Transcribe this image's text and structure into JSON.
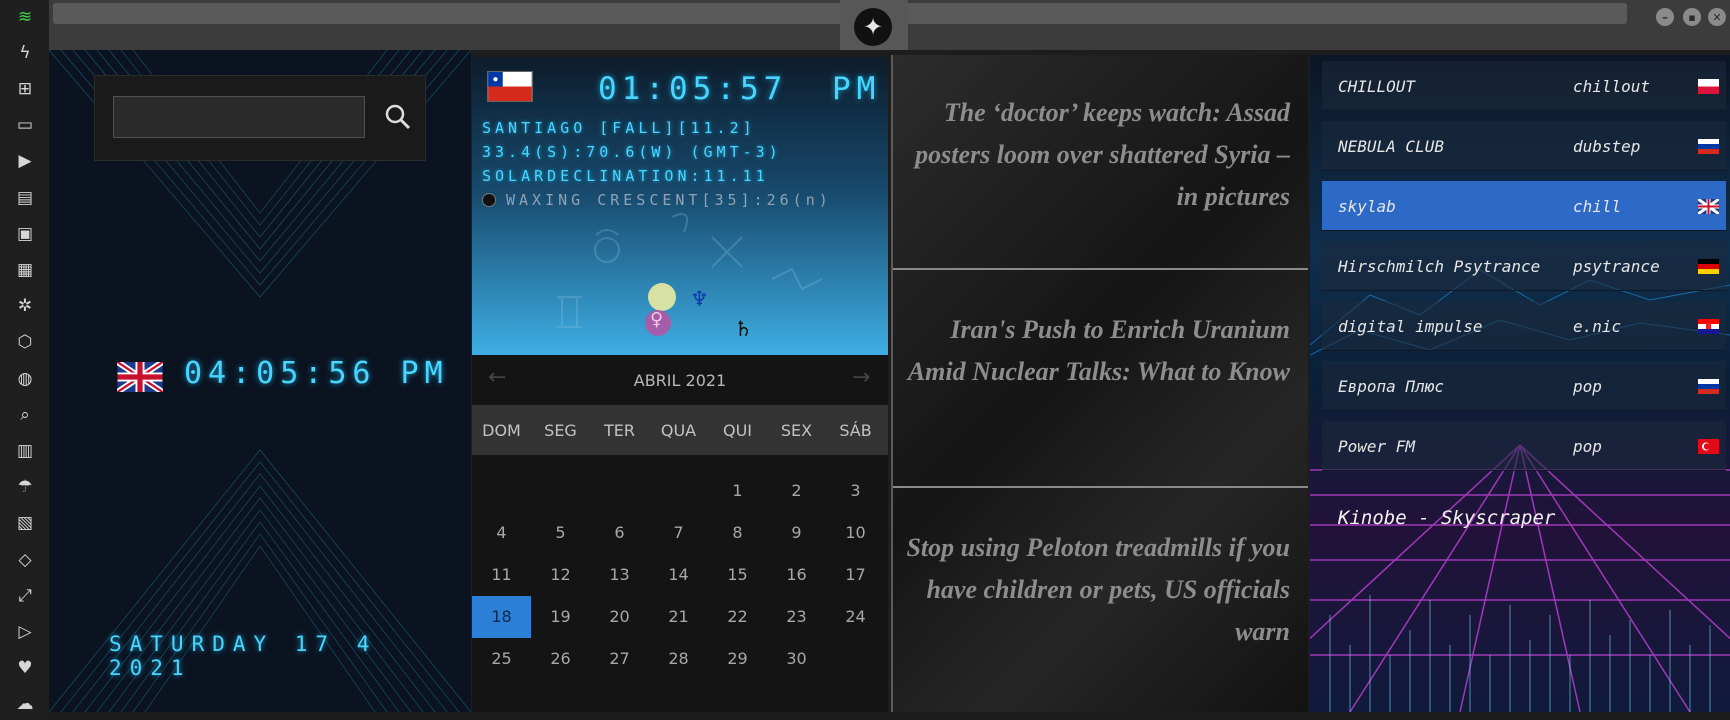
{
  "sidebar": {
    "icons": [
      "wifi-icon",
      "bolt-icon",
      "windows-icon",
      "archive-icon",
      "play-icon",
      "map-book-icon",
      "image-icon",
      "newspaper-icon",
      "aperture-icon",
      "hexagon-icon",
      "globe-icon",
      "search-icon",
      "map-icon",
      "umbrella-icon",
      "contact-card-icon",
      "code-icon",
      "expand-icon",
      "youtube-icon",
      "heart-icon",
      "cloud-icon"
    ]
  },
  "local_clock": {
    "time": "04:05:56 PM",
    "date": "SATURDAY 17 4 2021"
  },
  "search": {
    "value": "",
    "placeholder": ""
  },
  "remote_clock": {
    "time": "01:05:57",
    "ampm": "PM",
    "location": "SANTIAGO [FALL][11.2]",
    "coords": "33.4(S):70.6(W) (GMT-3)",
    "solar": "SOLARDECLINATION:11.11",
    "moon": "WAXING CRESCENT[35]:26(n)"
  },
  "planets": {
    "neptune": "♆",
    "venus": "♀",
    "saturn": "♄"
  },
  "calendar": {
    "title": "ABRIL 2021",
    "prev": "←",
    "next": "→",
    "weekdays": [
      "DOM",
      "SEG",
      "TER",
      "QUA",
      "QUI",
      "SEX",
      "SÁB"
    ],
    "days": [
      "1",
      "2",
      "3",
      "4",
      "5",
      "6",
      "7",
      "8",
      "9",
      "10",
      "11",
      "12",
      "13",
      "14",
      "15",
      "16",
      "17",
      "18",
      "19",
      "20",
      "21",
      "22",
      "23",
      "24",
      "25",
      "26",
      "27",
      "28",
      "29",
      "30"
    ],
    "selected": "18"
  },
  "news": [
    "The ‘doctor’ keeps watch: Assad posters loom over shattered Syria – in pictures",
    "Iran's Push to Enrich Uranium Amid Nuclear Talks: What to Know",
    "Stop using Peloton treadmills if you have children or pets, US officials warn"
  ],
  "radio": {
    "stations": [
      {
        "name": "CHILLOUT",
        "genre": "chillout",
        "country": "poland"
      },
      {
        "name": "NEBULA CLUB",
        "genre": "dubstep",
        "country": "russia"
      },
      {
        "name": "skylab",
        "genre": "chill",
        "country": "uk"
      },
      {
        "name": "Hirschmilch Psytrance",
        "genre": "psytrance",
        "country": "germany"
      },
      {
        "name": "digital impulse",
        "genre": "e.nic",
        "country": "croatia"
      },
      {
        "name": "Европа Плюс",
        "genre": "pop",
        "country": "russia"
      },
      {
        "name": "Power FM",
        "genre": "pop",
        "country": "turkey"
      }
    ],
    "now_playing": "Kinobe - Skyscraper"
  },
  "colors": {
    "accent": "#48d6ff",
    "selected": "#2c7fd6"
  }
}
